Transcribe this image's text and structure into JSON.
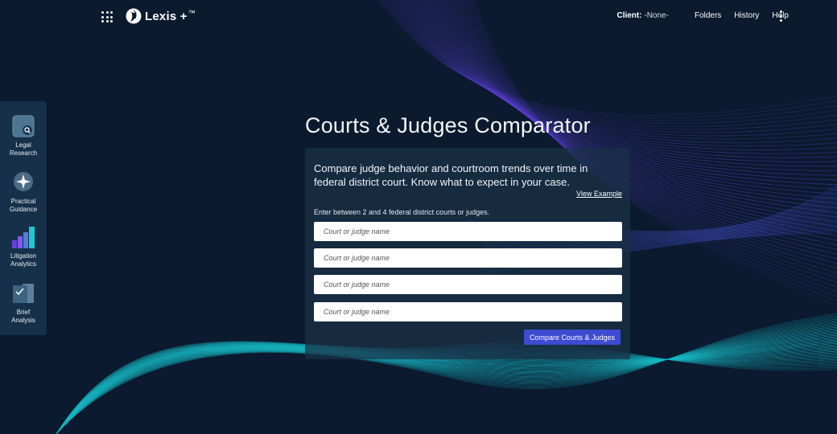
{
  "header": {
    "brand": "Lexis",
    "brand_suffix": "+",
    "brand_mark": "™",
    "client_label": "Client:",
    "client_value": "-None-",
    "nav": [
      "Folders",
      "History",
      "Help"
    ]
  },
  "rail": {
    "items": [
      {
        "label": "Legal\nResearch",
        "icon": "legal-research-icon"
      },
      {
        "label": "Practical\nGuidance",
        "icon": "practical-guidance-icon"
      },
      {
        "label": "Litigation\nAnalytics",
        "icon": "litigation-analytics-icon"
      },
      {
        "label": "Brief\nAnalysis",
        "icon": "brief-analysis-icon"
      }
    ]
  },
  "main": {
    "title": "Courts & Judges Comparator",
    "intro": "Compare judge behavior and courtroom trends over time in federal district court. Know what to expect in your case.",
    "view_example": "View Example",
    "hint": "Enter between 2 and 4 federal district courts or judges.",
    "fields": [
      {
        "placeholder": "Court or judge name",
        "value": ""
      },
      {
        "placeholder": "Court or judge name",
        "value": ""
      },
      {
        "placeholder": "Court or judge name",
        "value": ""
      },
      {
        "placeholder": "Court or judge name",
        "value": ""
      }
    ],
    "submit_label": "Compare Courts & Judges"
  },
  "colors": {
    "background": "#0b1a2e",
    "rail": "#17304a",
    "accent_button": "#3d4bd1",
    "wave_purple": "#5b3fd6",
    "wave_teal": "#17b8c4"
  }
}
